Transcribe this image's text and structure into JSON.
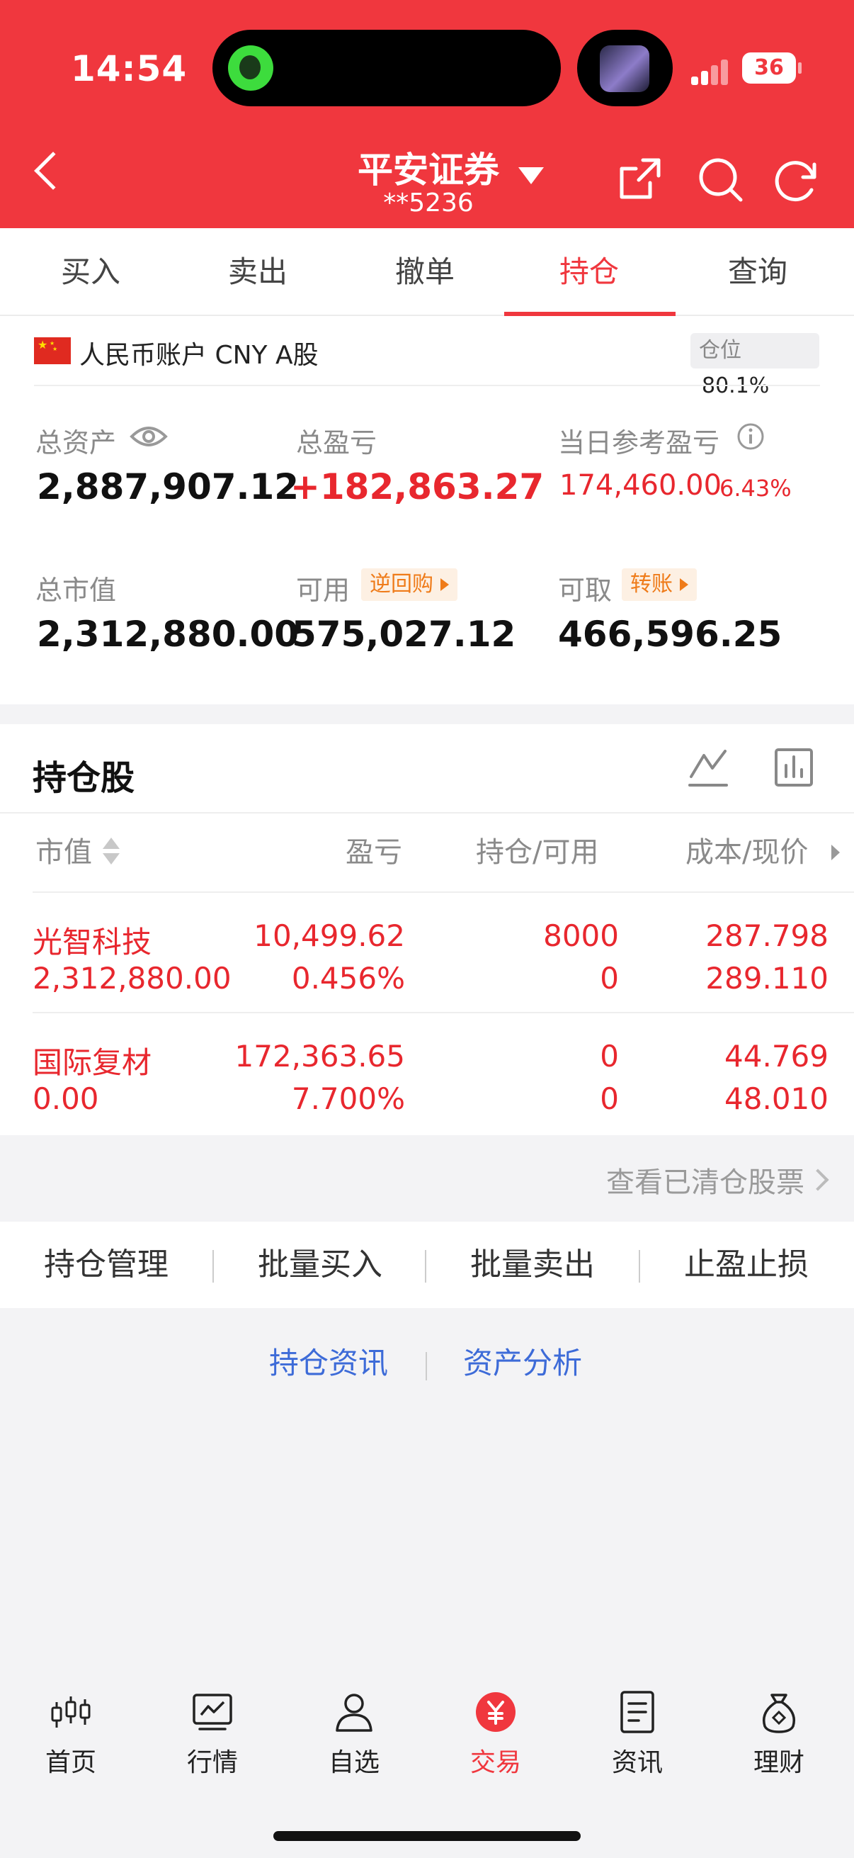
{
  "status_bar": {
    "time": "14:54",
    "battery": "36"
  },
  "header": {
    "broker": "平安证券",
    "account": "**5236"
  },
  "tabs": [
    {
      "label": "买入"
    },
    {
      "label": "卖出"
    },
    {
      "label": "撤单"
    },
    {
      "label": "持仓",
      "active": true
    },
    {
      "label": "查询"
    }
  ],
  "account": {
    "label": "人民币账户 CNY A股",
    "position_label": "仓位",
    "position_pct": "80.1%"
  },
  "summary": {
    "total_assets_label": "总资产",
    "total_assets": "2,887,907.12",
    "total_pl_label": "总盈亏",
    "total_pl": "+182,863.27",
    "today_pl_label": "当日参考盈亏",
    "today_pl": "174,460.00",
    "today_pl_pct": "6.43%",
    "market_value_label": "总市值",
    "market_value": "2,312,880.00",
    "available_label": "可用",
    "available_tag": "逆回购",
    "available": "575,027.12",
    "withdrawable_label": "可取",
    "withdrawable_tag": "转账",
    "withdrawable": "466,596.25"
  },
  "holdings": {
    "title": "持仓股",
    "columns": [
      "市值",
      "盈亏",
      "持仓/可用",
      "成本/现价"
    ],
    "rows": [
      {
        "name": "光智科技",
        "market_value": "2,312,880.00",
        "pl": "10,499.62",
        "pl_pct": "0.456%",
        "position": "8000",
        "available": "0",
        "cost": "287.798",
        "price": "289.110"
      },
      {
        "name": "国际复材",
        "market_value": "0.00",
        "pl": "172,363.65",
        "pl_pct": "7.700%",
        "position": "0",
        "available": "0",
        "cost": "44.769",
        "price": "48.010"
      }
    ],
    "cleared_link": "查看已清仓股票"
  },
  "actions": [
    "持仓管理",
    "批量买入",
    "批量卖出",
    "止盈止损"
  ],
  "links": [
    "持仓资讯",
    "资产分析"
  ],
  "bottom_nav": [
    {
      "label": "首页",
      "icon": "candlestick-icon"
    },
    {
      "label": "行情",
      "icon": "trend-chart-icon"
    },
    {
      "label": "自选",
      "icon": "person-icon"
    },
    {
      "label": "交易",
      "icon": "yuan-coin-icon",
      "active": true
    },
    {
      "label": "资讯",
      "icon": "document-icon"
    },
    {
      "label": "理财",
      "icon": "money-bag-icon"
    }
  ],
  "colors": {
    "brand_red": "#f0373e",
    "gain_red": "#e8272e",
    "link_blue": "#3d6bd8",
    "tag_orange": "#ef7b19"
  }
}
